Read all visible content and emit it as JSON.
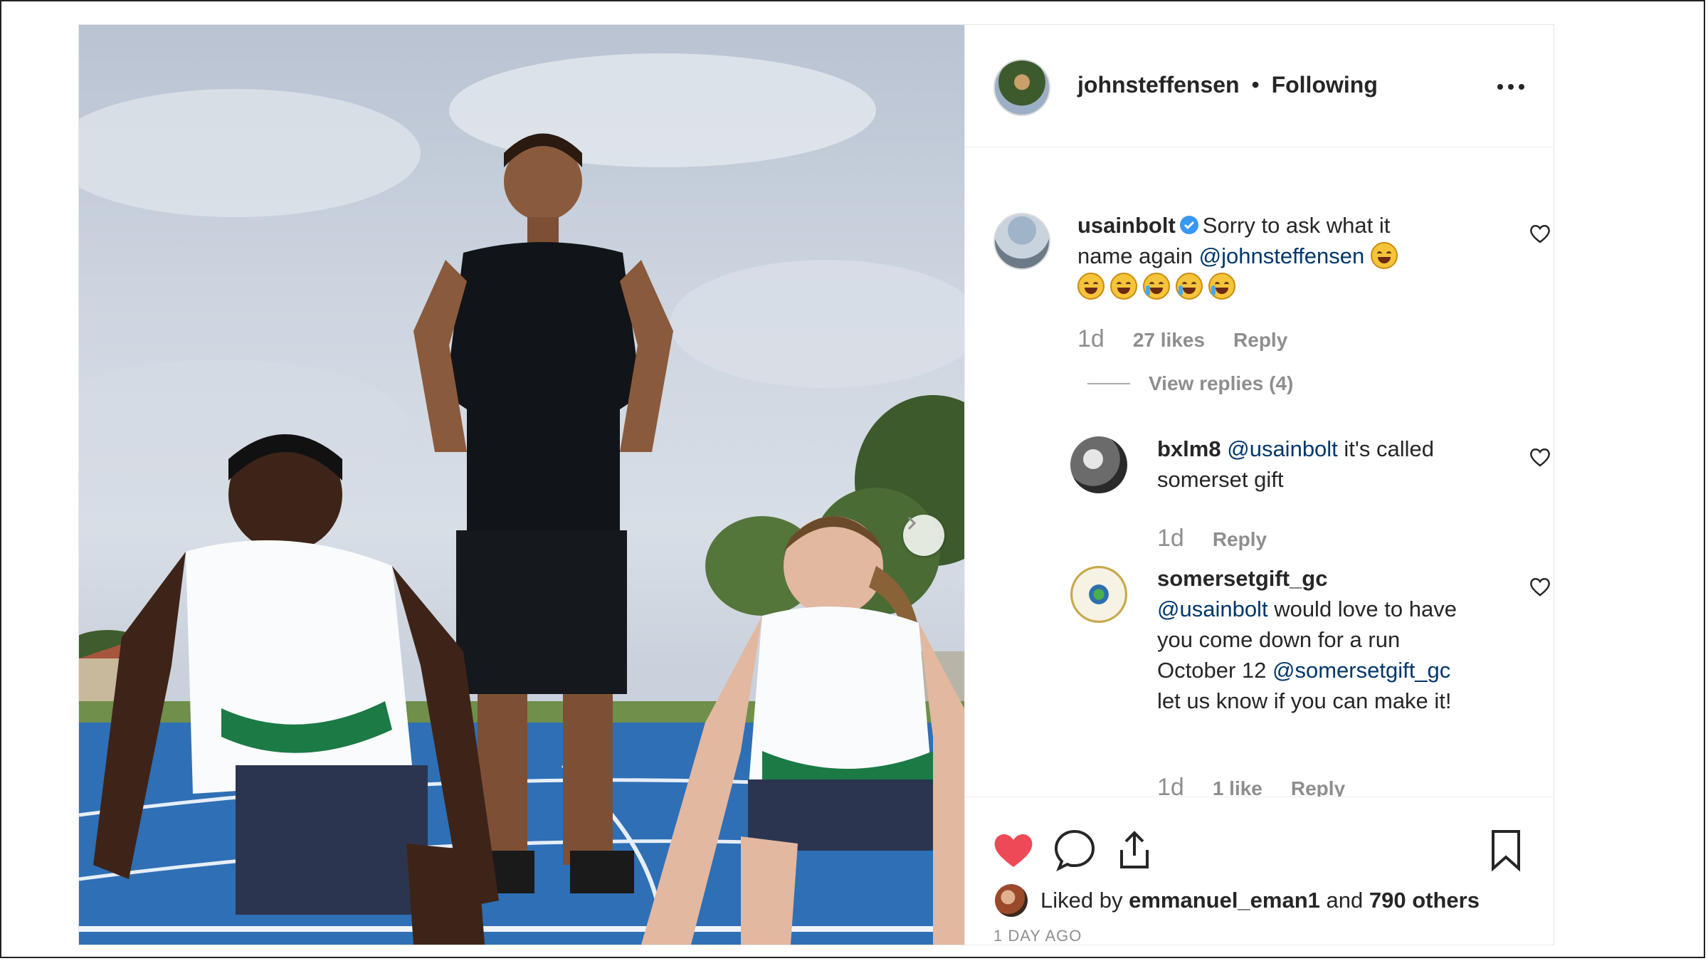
{
  "header": {
    "username": "johnsteffensen",
    "separator": "•",
    "follow_status": "Following"
  },
  "comments": {
    "main": {
      "username": "usainbolt",
      "text_1": "Sorry to ask what it name again",
      "mention": "@johnsteffensen",
      "time": "1d",
      "likes": "27 likes",
      "reply": "Reply",
      "view_replies": "View replies (4)"
    },
    "reply_1": {
      "username": "bxlm8",
      "mention": "@usainbolt",
      "text": "it's called somerset gift",
      "time": "1d",
      "reply": "Reply"
    },
    "reply_2": {
      "username": "somersetgift_gc",
      "mention_1": "@usainbolt",
      "text_1": "would love to have you come down for a run October 12",
      "mention_2": "@somersetgift_gc",
      "text_2": "let us know if you can make it!",
      "time": "1d",
      "likes": "1 like",
      "reply": "Reply"
    }
  },
  "actions": {
    "liked_by_prefix": "Liked by",
    "liked_by_user": "emmanuel_eman1",
    "liked_by_and": "and",
    "liked_by_others": "790 others",
    "posted_time": "1 DAY AGO"
  },
  "colors": {
    "like_red": "#ed4956",
    "verified_blue": "#3897f0",
    "mention_blue": "#00376b"
  }
}
